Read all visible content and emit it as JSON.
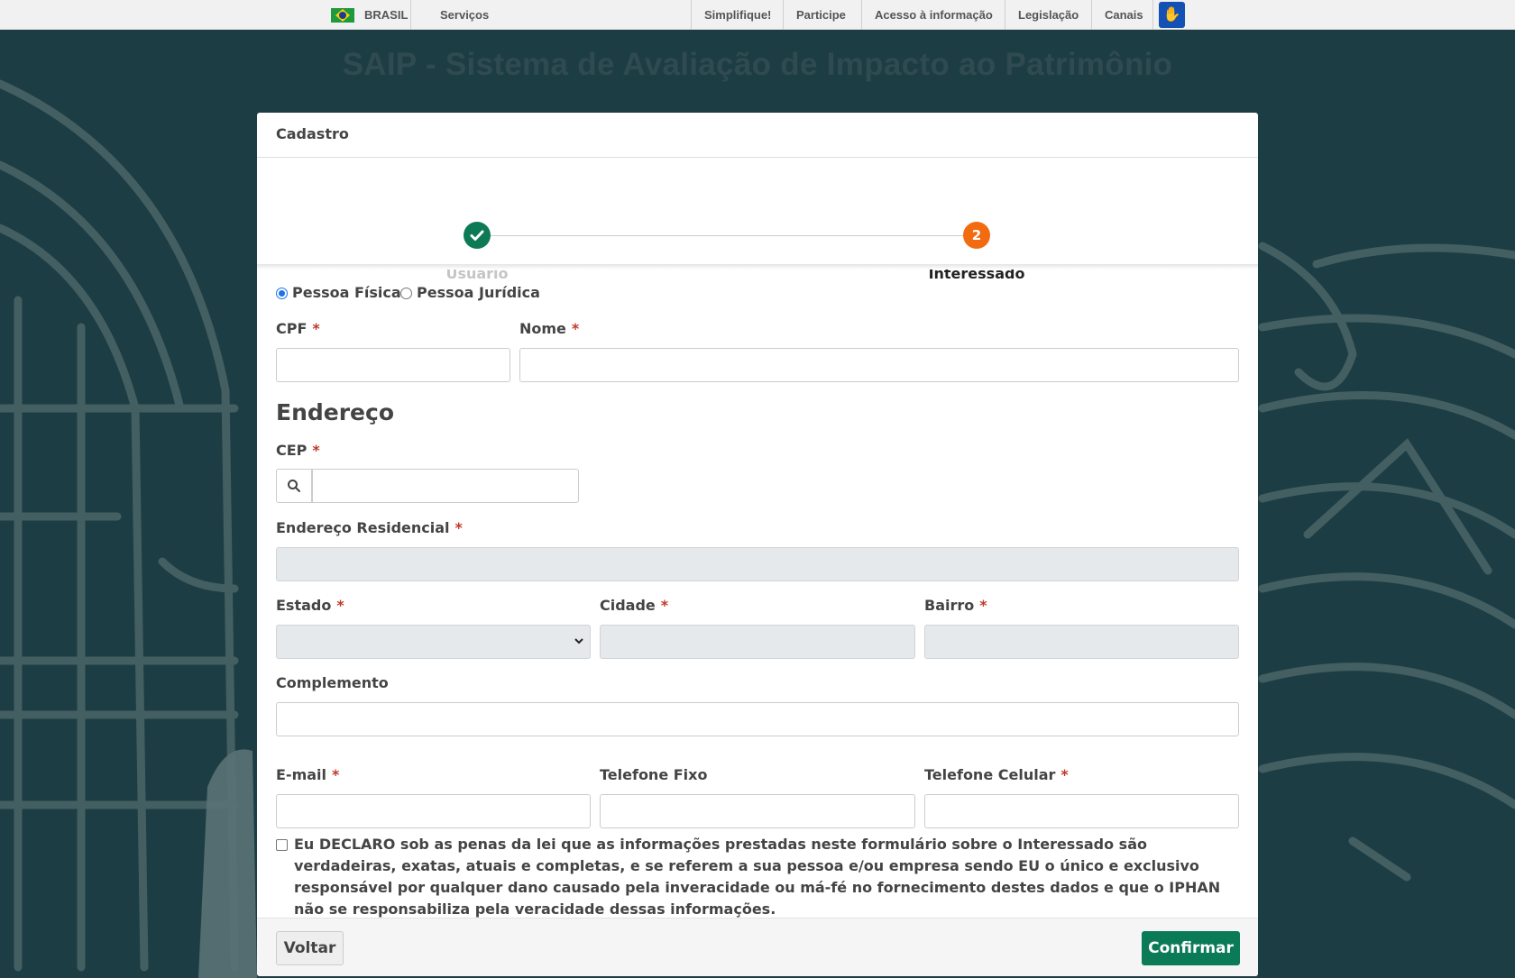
{
  "govbar": {
    "country": "BRASIL",
    "services": "Serviços",
    "links": [
      "Simplifique!",
      "Participe",
      "Acesso à informação",
      "Legislação",
      "Canais"
    ],
    "libras_icon": "hand-sign-icon"
  },
  "page": {
    "title": "SAIP - Sistema de Avaliação de Impacto ao Patrimônio"
  },
  "card": {
    "header": "Cadastro",
    "steps": [
      {
        "label": "Usuário",
        "state": "done",
        "icon": "check-icon"
      },
      {
        "label": "Interessado",
        "number": "2",
        "state": "active"
      }
    ],
    "person_type": {
      "options": [
        "Pessoa Física",
        "Pessoa Jurídica"
      ],
      "selected": "Pessoa Física"
    },
    "fields": {
      "cpf": {
        "label": "CPF",
        "value": ""
      },
      "nome": {
        "label": "Nome",
        "value": ""
      },
      "cep": {
        "label": "CEP",
        "value": "",
        "icon": "search-icon"
      },
      "endereco": {
        "label": "Endereço Residencial",
        "value": ""
      },
      "estado": {
        "label": "Estado",
        "value": ""
      },
      "cidade": {
        "label": "Cidade",
        "value": ""
      },
      "bairro": {
        "label": "Bairro",
        "value": ""
      },
      "complemento": {
        "label": "Complemento",
        "value": ""
      },
      "email": {
        "label": "E-mail",
        "value": ""
      },
      "telefone_fixo": {
        "label": "Telefone Fixo",
        "value": ""
      },
      "telefone_celular": {
        "label": "Telefone Celular",
        "value": ""
      }
    },
    "required_mark": "*",
    "address_section": "Endereço",
    "declaration": "Eu DECLARO sob as penas da lei que as informações prestadas neste formulário sobre o Interessado são verdadeiras, exatas, atuais e completas, e se referem a sua pessoa e/ou empresa sendo EU o único e exclusivo responsável por qualquer dano causado pela inveracidade ou má-fé no fornecimento destes dados e que o IPHAN não se responsabiliza pela veracidade dessas informações.",
    "buttons": {
      "back": "Voltar",
      "confirm": "Confirmar"
    }
  },
  "colors": {
    "background": "#1d3d44",
    "confirm": "#0b7a57",
    "step_done": "#0e7a55",
    "step_active": "#f26b11",
    "required": "#c0392b"
  }
}
